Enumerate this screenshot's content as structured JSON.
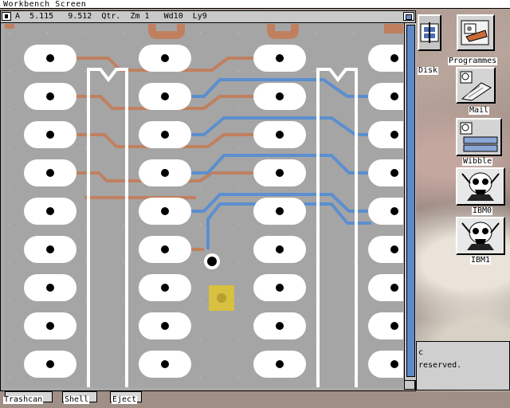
{
  "screen": {
    "title": "Workbench Screen"
  },
  "window": {
    "status_text": "A  5.115   9.512  Qtr.  Zm 1   Wd10  Ly9"
  },
  "pcb": {
    "pad_rows": 9,
    "pad_columns": 4,
    "trace_color_top": "#c08060",
    "trace_color_bottom": "#5b8fcf",
    "via_pad_color": "#d8c040",
    "silkscreen_color": "#ffffff",
    "board_color": "#a5a5a5"
  },
  "desktop_icons": [
    {
      "name": "disk",
      "label": "Disk"
    },
    {
      "name": "programmes",
      "label": "Programmes"
    },
    {
      "name": "mail",
      "label": "Mail"
    },
    {
      "name": "wibble",
      "label": "Wibble"
    },
    {
      "name": "ibm0",
      "label": "IBM0"
    },
    {
      "name": "ibm1",
      "label": "IBM1"
    }
  ],
  "shell": {
    "lines": [
      "c",
      "reserved."
    ]
  },
  "bottom_icons": [
    {
      "name": "trashcan",
      "label": "Trashcan"
    },
    {
      "name": "shell",
      "label": "Shell"
    },
    {
      "name": "eject",
      "label": "Eject"
    }
  ]
}
